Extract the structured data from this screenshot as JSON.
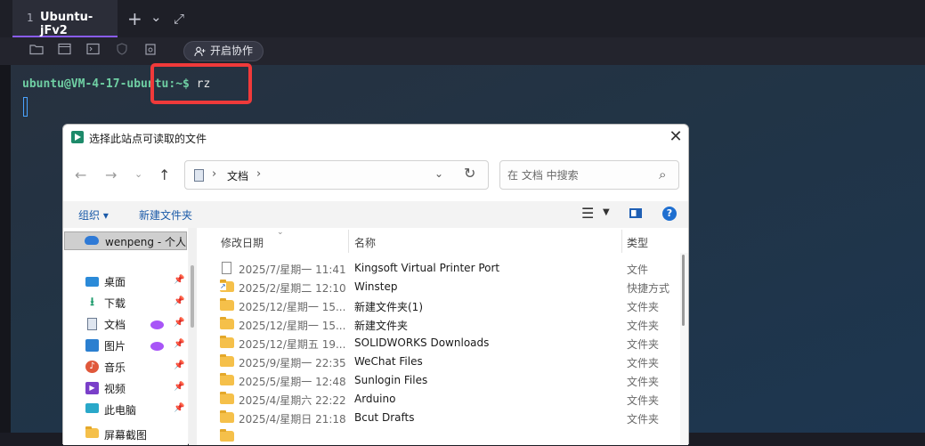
{
  "tabbar": {
    "tab": {
      "number": "1",
      "title": "Ubuntu-jFv2"
    },
    "add_icon": "+",
    "dropdown_icon": "⌄",
    "expand_icon": "⤢"
  },
  "toolbar": {
    "icons": [
      "folder-icon",
      "window-icon",
      "terminal-icon",
      "shield-icon",
      "clipboard-icon"
    ],
    "collab_label": "开启协作"
  },
  "terminal": {
    "user_host": "ubuntu@VM-4-17-ubuntu",
    "path": ":~$",
    "command": " rz"
  },
  "dialog": {
    "title": "选择此站点可读取的文件",
    "close": "✕",
    "address": {
      "location": "文档"
    },
    "search": {
      "placeholder": "在 文档 中搜索"
    },
    "commands": {
      "organize": "组织 ▾",
      "new_folder": "新建文件夹"
    },
    "sidebar": {
      "onedrive": "wenpeng - 个人",
      "items": [
        {
          "label": "桌面",
          "pinned": true
        },
        {
          "label": "下载",
          "pinned": true
        },
        {
          "label": "文档",
          "pinned": true
        },
        {
          "label": "图片",
          "pinned": true
        },
        {
          "label": "音乐",
          "pinned": true
        },
        {
          "label": "视频",
          "pinned": true
        },
        {
          "label": "此电脑",
          "pinned": true
        },
        {
          "label": "屏幕截图",
          "pinned": false
        }
      ]
    },
    "columns": {
      "date": "修改日期",
      "name": "名称",
      "type": "类型"
    },
    "files": [
      {
        "date": "2025/7/星期一 11:41",
        "name": "Kingsoft Virtual Printer Port",
        "type": "文件",
        "kind": "file"
      },
      {
        "date": "2025/2/星期二 12:10",
        "name": "Winstep",
        "type": "快捷方式",
        "kind": "shortcut"
      },
      {
        "date": "2025/12/星期一 15...",
        "name": "新建文件夹(1)",
        "type": "文件夹",
        "kind": "folder"
      },
      {
        "date": "2025/12/星期一 15...",
        "name": "新建文件夹",
        "type": "文件夹",
        "kind": "folder"
      },
      {
        "date": "2025/12/星期五 19...",
        "name": "SOLIDWORKS Downloads",
        "type": "文件夹",
        "kind": "folder"
      },
      {
        "date": "2025/9/星期一 22:35",
        "name": "WeChat Files",
        "type": "文件夹",
        "kind": "folder"
      },
      {
        "date": "2025/5/星期一 12:48",
        "name": "Sunlogin Files",
        "type": "文件夹",
        "kind": "folder"
      },
      {
        "date": "2025/4/星期六 22:22",
        "name": "Arduino",
        "type": "文件夹",
        "kind": "folder"
      },
      {
        "date": "2025/4/星期日 21:18",
        "name": "Bcut Drafts",
        "type": "文件夹",
        "kind": "folder"
      }
    ]
  }
}
